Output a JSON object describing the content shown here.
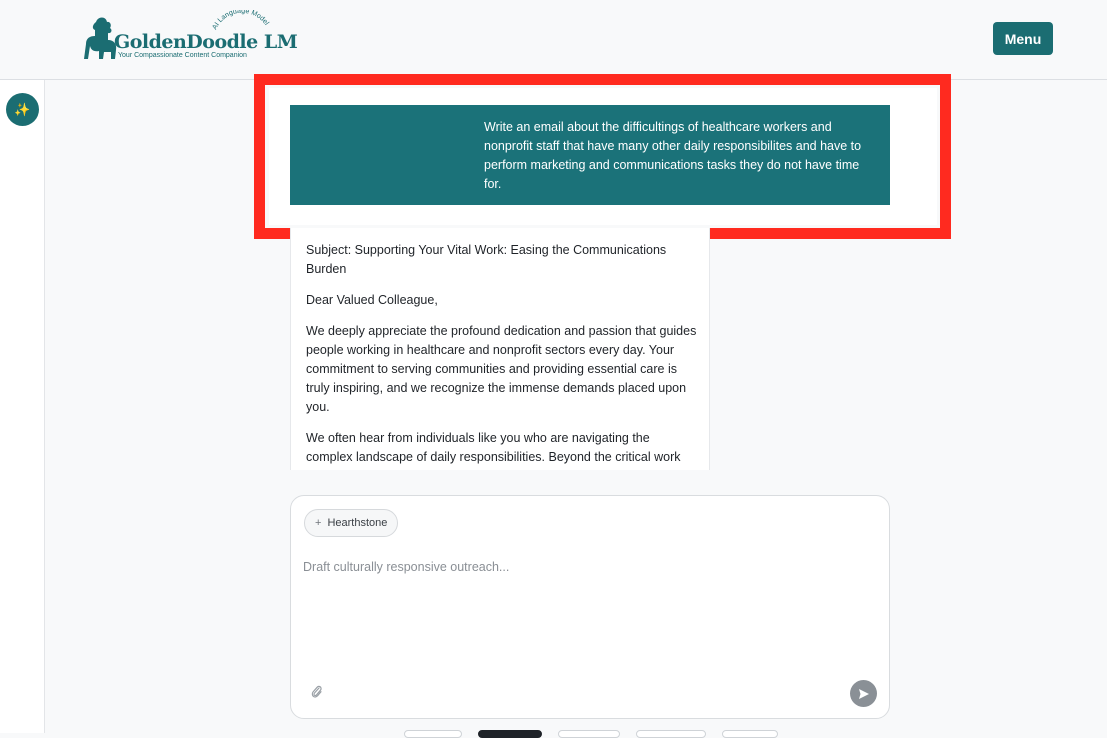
{
  "header": {
    "logo_title": "GoldenDoodle LM",
    "logo_tagline": "Your Compassionate Content Companion",
    "logo_arc": "AI Language Model",
    "menu_label": "Menu"
  },
  "sidebar": {
    "new_chat_icon": "sparkles-icon"
  },
  "conversation": {
    "user_message": "Write an email about the difficultings of healthcare workers and nonprofit staff that have many other daily responsibilites and have to perform marketing and communications tasks they do not have time for.",
    "response_paragraphs": [
      "Subject: Supporting Your Vital Work: Easing the Communications Burden",
      "Dear Valued Colleague,",
      "We deeply appreciate the profound dedication and passion that guides people working in healthcare and nonprofit sectors every day. Your commitment to serving communities and providing essential care is truly inspiring, and we recognize the immense demands placed upon you.",
      "We often hear from individuals like you who are navigating the complex landscape of daily responsibilities. Beyond the critical work"
    ]
  },
  "composer": {
    "chip_label": "Hearthstone",
    "placeholder": "Draft culturally responsive outreach...",
    "attach_icon": "paperclip-icon",
    "send_icon": "send-icon"
  },
  "colors": {
    "brand": "#1b6d72",
    "highlight": "#ff2a1f"
  }
}
